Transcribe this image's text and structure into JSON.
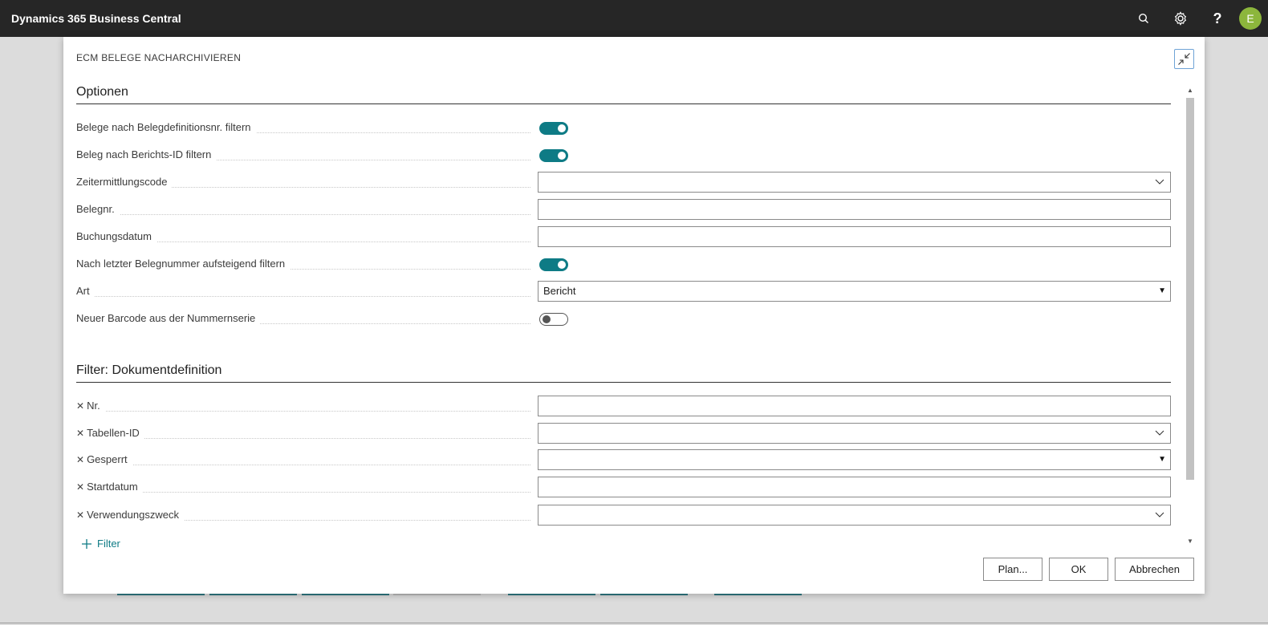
{
  "app": {
    "title": "Dynamics 365 Business Central",
    "user_initial": "E"
  },
  "dialog": {
    "title": "ECM BELEGE NACHARCHIVIEREN",
    "sections": {
      "options": {
        "title": "Optionen",
        "fields": [
          {
            "label": "Belege nach Belegdefinitionsnr. filtern",
            "type": "toggle",
            "value": true
          },
          {
            "label": "Beleg nach Berichts-ID filtern",
            "type": "toggle",
            "value": true
          },
          {
            "label": "Zeitermittlungscode",
            "type": "lookup",
            "value": ""
          },
          {
            "label": "Belegnr.",
            "type": "text",
            "value": ""
          },
          {
            "label": "Buchungsdatum",
            "type": "text",
            "value": ""
          },
          {
            "label": "Nach letzter Belegnummer aufsteigend filtern",
            "type": "toggle",
            "value": true
          },
          {
            "label": "Art",
            "type": "select",
            "value": "Bericht"
          },
          {
            "label": "Neuer Barcode aus der Nummernserie",
            "type": "toggle",
            "value": false
          }
        ]
      },
      "filter": {
        "title": "Filter: Dokumentdefinition",
        "fields": [
          {
            "label": "Nr.",
            "type": "text",
            "value": ""
          },
          {
            "label": "Tabellen-ID",
            "type": "lookup",
            "value": ""
          },
          {
            "label": "Gesperrt",
            "type": "select",
            "value": ""
          },
          {
            "label": "Startdatum",
            "type": "text",
            "value": ""
          },
          {
            "label": "Verwendungszweck",
            "type": "lookup",
            "value": ""
          }
        ],
        "add_filter_label": "Filter"
      }
    },
    "buttons": {
      "plan": "Plan...",
      "ok": "OK",
      "cancel": "Abbrechen"
    }
  },
  "colors": {
    "accent": "#0e7b85",
    "topbar": "#262626",
    "avatar": "#8cb63c"
  }
}
